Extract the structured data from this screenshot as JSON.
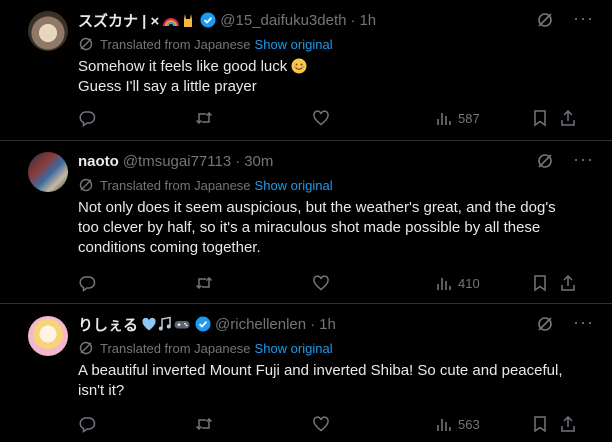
{
  "colors": {
    "background": "#000000",
    "text": "#e7e9ea",
    "muted": "#71767b",
    "link": "#1d9bf0",
    "verified": "#1d9bf0",
    "divider": "#2f3336"
  },
  "tweets": [
    {
      "name": "スズカナ | ×",
      "handle": "@15_daifuku3deth",
      "time": "1h",
      "verified": true,
      "translated_label": "Translated from Japanese",
      "show_original": "Show original",
      "lines": [
        "Somehow it feels like good luck",
        "Guess I'll say a little prayer"
      ],
      "views": "587"
    },
    {
      "name": "naoto",
      "handle": "@tmsugai77113",
      "time": "30m",
      "verified": false,
      "translated_label": "Translated from Japanese",
      "show_original": "Show original",
      "lines": [
        "Not only does it seem auspicious, but the weather's great, and the dog's",
        "too clever by half, so it's a miraculous shot made possible by all these",
        "conditions coming together."
      ],
      "views": "410"
    },
    {
      "name": "りしぇる",
      "handle": "@richellenlen",
      "time": "1h",
      "verified": true,
      "translated_label": "Translated from Japanese",
      "show_original": "Show original",
      "lines": [
        "A beautiful inverted Mount Fuji and inverted Shiba! So cute and peaceful,",
        "isn't it?"
      ],
      "views": "563"
    }
  ],
  "icons": [
    "translate-icon",
    "grok-icon",
    "more-icon",
    "reply-icon",
    "retweet-icon",
    "like-icon",
    "views-icon",
    "bookmark-icon",
    "share-icon",
    "verified-badge-icon"
  ]
}
